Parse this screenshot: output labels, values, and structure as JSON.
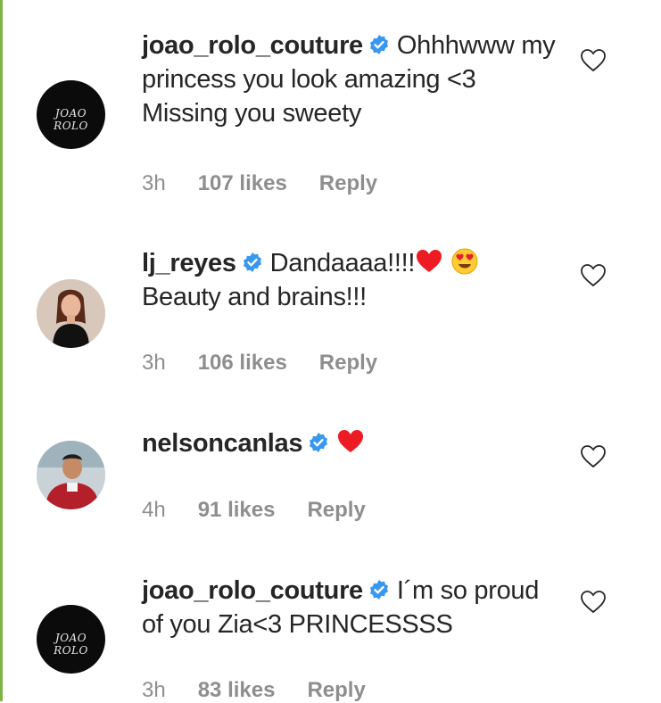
{
  "comments": [
    {
      "username": "joao_rolo_couture",
      "avatar_icon": "brand-logo-avatar",
      "avatar_text": "JOAO ROLO",
      "text": "Ohhhwww my princess you look amazing <3 Missing you sweety",
      "time": "3h",
      "likes": "107 likes",
      "reply": "Reply"
    },
    {
      "username": "lj_reyes",
      "avatar_icon": "profile-photo-avatar",
      "text": "Dandaaaa!!!!",
      "text_after": "Beauty and brains!!!",
      "emojis": [
        "red-heart-emoji",
        "heart-eyes-emoji"
      ],
      "time": "3h",
      "likes": "106 likes",
      "reply": "Reply"
    },
    {
      "username": "nelsoncanlas",
      "avatar_icon": "profile-photo-avatar",
      "text": "",
      "emojis": [
        "red-heart-emoji"
      ],
      "time": "4h",
      "likes": "91 likes",
      "reply": "Reply"
    },
    {
      "username": "joao_rolo_couture",
      "avatar_icon": "brand-logo-avatar",
      "avatar_text": "JOAO ROLO",
      "text": "I´m so proud of you Zia<3 PRINCESSSS",
      "time": "3h",
      "likes": "83 likes",
      "reply": "Reply"
    }
  ],
  "colors": {
    "text": "#262626",
    "meta": "#8e8e8e",
    "verified": "#3897f0",
    "heart_red": "#ed1c24",
    "left_edge": "#7cb342"
  }
}
